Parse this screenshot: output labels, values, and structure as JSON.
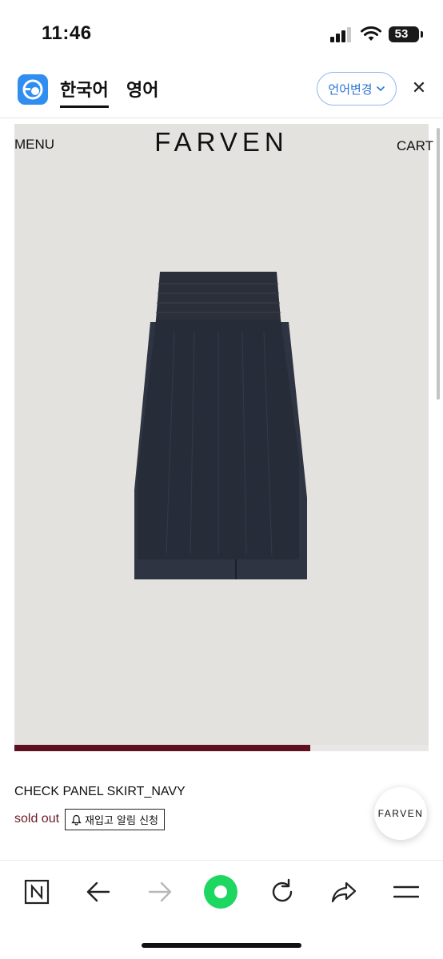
{
  "status_bar": {
    "time": "11:46",
    "battery": "53",
    "icons": [
      "signal-icon",
      "wifi-icon",
      "battery-icon"
    ]
  },
  "translate_bar": {
    "tabs": [
      "한국어",
      "영어"
    ],
    "active_tab": "한국어",
    "change_language_label": "언어변경",
    "close_label": "✕",
    "accent_color": "#2a73d6"
  },
  "site": {
    "menu_label": "MENU",
    "brand": "FARVEN",
    "cart_label": "CART"
  },
  "product": {
    "image_alt": "navy skirt",
    "image_slider_progress": 0.715,
    "name": "CHECK PANEL SKIRT_NAVY",
    "status": "sold out",
    "restock_label": "재입고 알림 신청",
    "floating_brand": "FARVEN",
    "status_color": "#6b1c26"
  },
  "toolbar": {
    "icons": [
      "naver-n-icon",
      "back-arrow-icon",
      "forward-arrow-icon",
      "green-dot-icon",
      "reload-icon",
      "share-icon",
      "menu-icon"
    ],
    "green_color": "#1ed760"
  }
}
